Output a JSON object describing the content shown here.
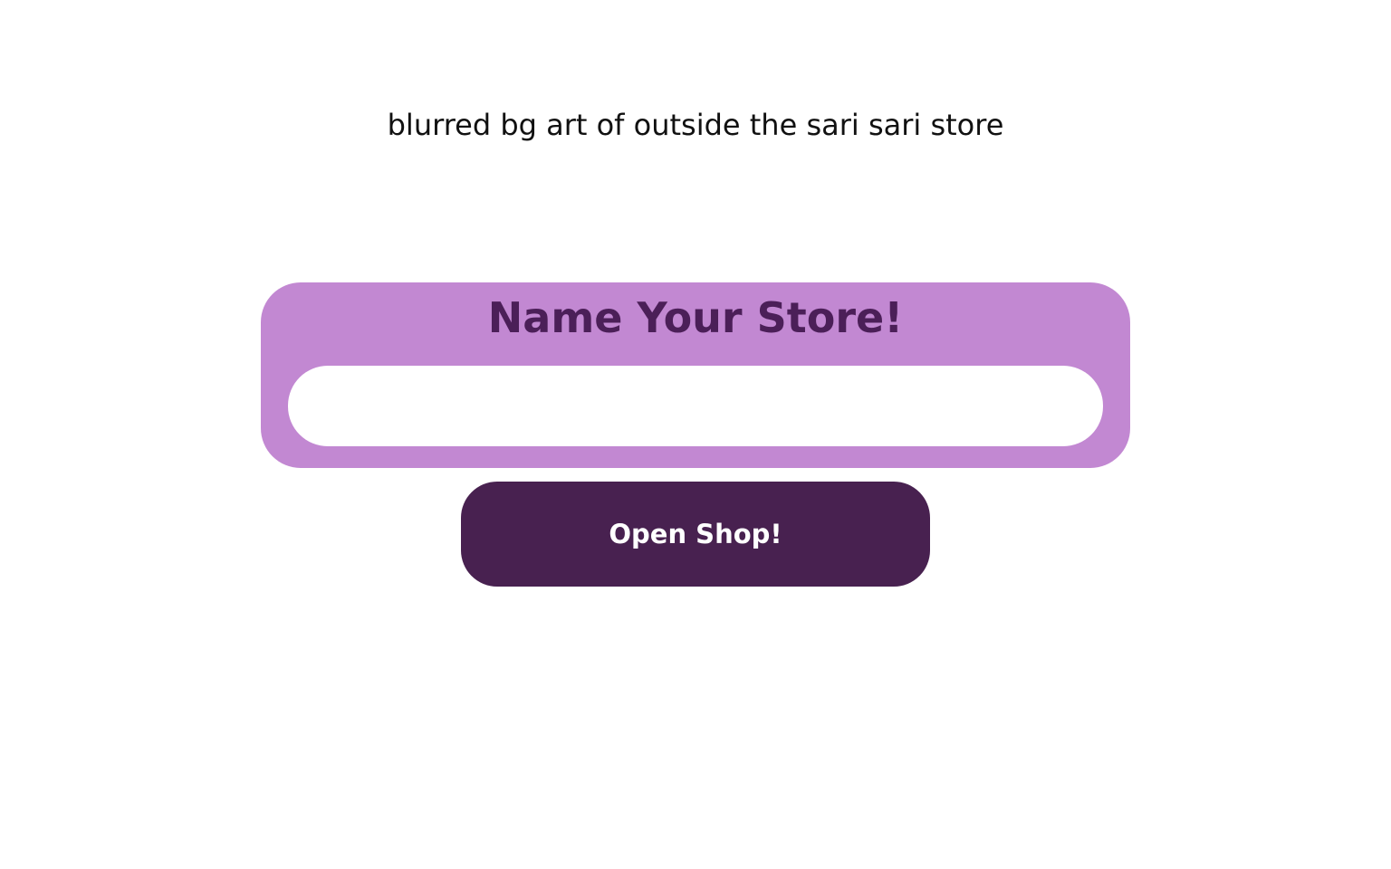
{
  "background_note": "blurred bg art of outside the sari sari store",
  "panel": {
    "title": "Name Your Store!",
    "input_value": "",
    "input_placeholder": ""
  },
  "open_button": {
    "label": "Open Shop!"
  },
  "colors": {
    "panel_bg": "#c288d2",
    "title_text": "#4b1f58",
    "button_bg": "#482150",
    "button_text": "#ffffff"
  }
}
